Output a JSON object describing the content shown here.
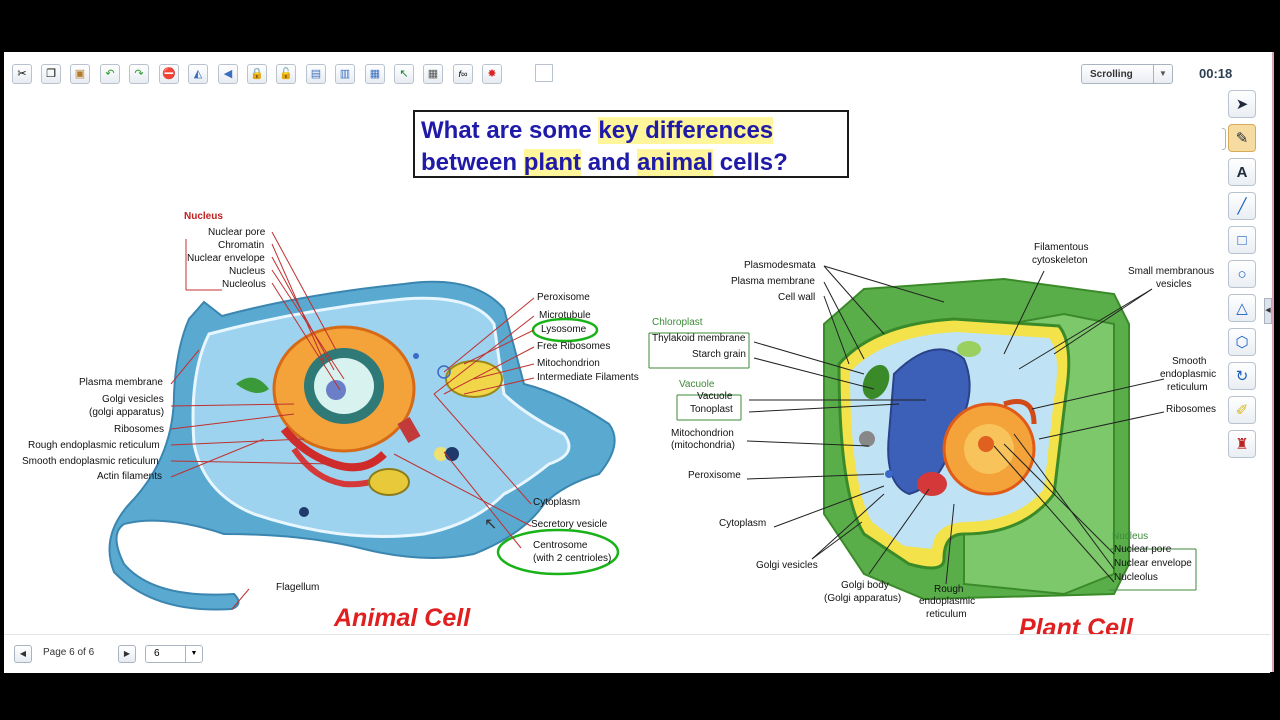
{
  "toolbar": {
    "icons": [
      "cut-icon",
      "copy-icon",
      "paste-icon",
      "undo-icon",
      "redo-icon",
      "delete-icon",
      "flip-icon",
      "arrow-left-icon",
      "lock-icon",
      "unlock-icon",
      "page-icon",
      "capture-icon",
      "screen-capture-icon",
      "select-arrow-icon",
      "grid-icon",
      "fx-icon",
      "burst-icon"
    ],
    "mode_select": "Scrolling",
    "timer": "00:18"
  },
  "question": {
    "line1_a": "What are some ",
    "line1_hl": "key differences",
    "line2_a": "between ",
    "line2_hl1": "plant",
    "line2_b": " and ",
    "line2_hl2": "animal",
    "line2_c": " cells?"
  },
  "animal_cell": {
    "title": "Animal Cell",
    "nucleus_header": "Nucleus",
    "labels_left": [
      "Nuclear pore",
      "Chromatin",
      "Nuclear envelope",
      "Nucleus",
      "Nucleolus",
      "Plasma membrane",
      "Golgi vesicles",
      "(golgi apparatus)",
      "Ribosomes",
      "Rough endoplasmic reticulum",
      "Smooth endoplasmic reticulum",
      "Actin filaments",
      "Flagellum"
    ],
    "labels_right": [
      "Peroxisome",
      "Microtubule",
      "Lysosome",
      "Free Ribosomes",
      "Mitochondrion",
      "Intermediate Filaments",
      "Cytoplasm",
      "Secretory vesicle",
      "Centrosome",
      "(with 2 centrioles)"
    ]
  },
  "plant_cell": {
    "title": "Plant Cell",
    "labels_left": [
      "Plasmodesmata",
      "Plasma membrane",
      "Cell wall",
      "Chloroplast",
      "Thylakoid membrane",
      "Starch grain",
      "Vacuole",
      "Vacuole",
      "Tonoplast",
      "Mitochondrion",
      "(mitochondria)",
      "Peroxisome",
      "Cytoplasm",
      "Golgi vesicles",
      "Golgi body",
      "(Golgi apparatus)",
      "Rough",
      "endoplasmic",
      "reticulum"
    ],
    "labels_right": [
      "Filamentous",
      "cytoskeleton",
      "Small membranous",
      "vesicles",
      "Smooth",
      "endoplasmic",
      "reticulum",
      "Ribosomes",
      "Nucleus",
      "Nuclear pore",
      "Nuclear envelope",
      "Nucleolus"
    ]
  },
  "pagination": {
    "page_text": "Page 6 of 6",
    "page_select": "6"
  },
  "colors": {
    "question_text": "#1f1aa7",
    "title_red": "#e02020",
    "highlight": "#fff59a",
    "pen_green": "#19b319"
  }
}
